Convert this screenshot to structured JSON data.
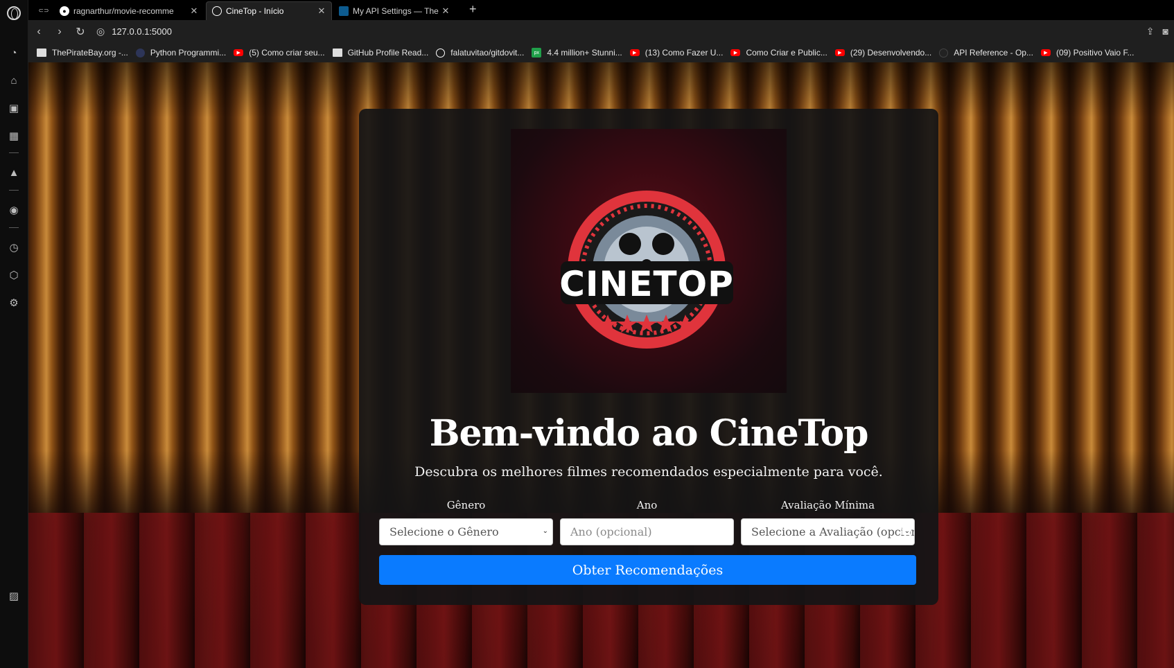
{
  "browser": {
    "tabs": [
      {
        "title": "ragnarthur/movie-recomme",
        "favicon": "github-icon"
      },
      {
        "title": "CineTop - Início",
        "favicon": "globe-icon",
        "active": true
      },
      {
        "title": "My API Settings — The Mo",
        "favicon": "tmdb-icon"
      }
    ],
    "url": "127.0.0.1:5000",
    "bookmarks": [
      {
        "label": "ThePirateBay.org -...",
        "icon": "piratebay-icon"
      },
      {
        "label": "Python Programmi...",
        "icon": "site-icon"
      },
      {
        "label": "(5) Como criar seu...",
        "icon": "youtube-icon"
      },
      {
        "label": "GitHub Profile Read...",
        "icon": "site-icon"
      },
      {
        "label": "falatuvitao/gitdovit...",
        "icon": "github-icon"
      },
      {
        "label": "4.4 million+ Stunni...",
        "icon": "pixabay-icon"
      },
      {
        "label": "(13) Como Fazer U...",
        "icon": "youtube-icon"
      },
      {
        "label": "Como Criar e Public...",
        "icon": "youtube-icon"
      },
      {
        "label": "(29) Desenvolvendo...",
        "icon": "youtube-icon"
      },
      {
        "label": "API Reference - Op...",
        "icon": "openai-icon"
      },
      {
        "label": "(09) Positivo Vaio F...",
        "icon": "youtube-icon"
      }
    ]
  },
  "page": {
    "logo_text": "CINETOP",
    "title": "Bem-vindo ao CineTop",
    "subtitle": "Descubra os melhores filmes recomendados especialmente para você.",
    "form": {
      "genre_label": "Gênero",
      "genre_selected": "Selecione o Gênero",
      "year_label": "Ano",
      "year_placeholder": "Ano (opcional)",
      "rating_label": "Avaliação Mínima",
      "rating_selected": "Selecione a Avaliação (opcional)",
      "submit_label": "Obter Recomendações"
    }
  },
  "colors": {
    "accent": "#0a7bff",
    "logo_red": "#e0343c"
  }
}
